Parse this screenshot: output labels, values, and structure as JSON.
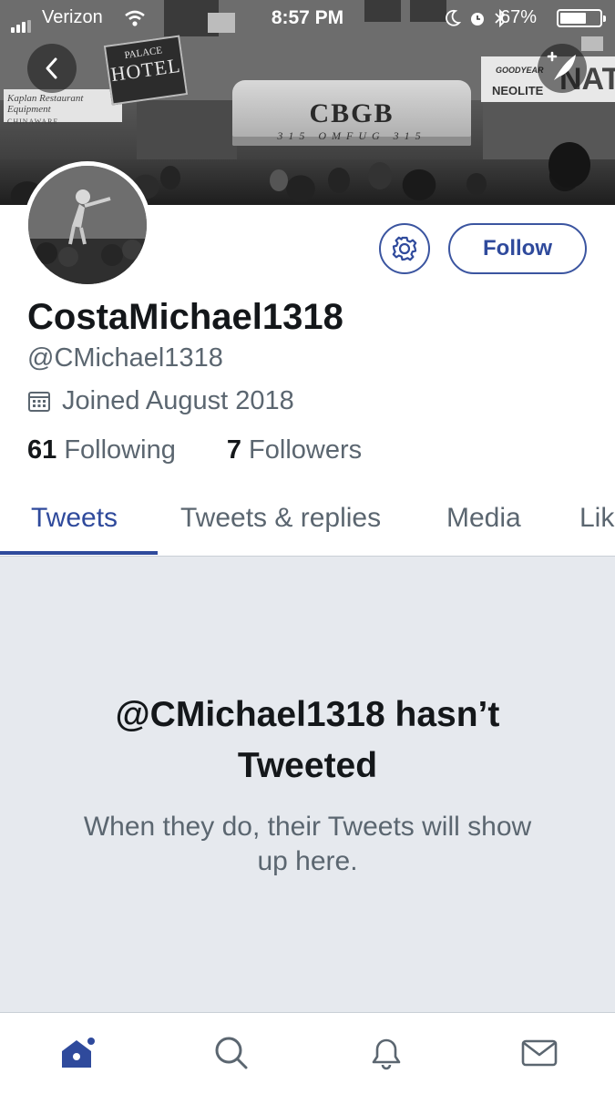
{
  "status_bar": {
    "carrier": "Verizon",
    "time": "8:57 PM",
    "battery": "67%",
    "battery_level": 0.67
  },
  "banner": {
    "hotel_sign_top": "PALACE",
    "hotel_sign_bottom": "HOTEL",
    "store_sign": "Kaplan Restaurant Equipment",
    "store_sign_small": "CHINAWARE",
    "awning_main": "CBGB",
    "awning_sub": "315  OMFUG  315",
    "shop_sign_logo": "GOODYEAR",
    "shop_sign_a": "NEOLITE",
    "shop_sign_b": "NATI"
  },
  "profile": {
    "display_name": "CostaMichael1318",
    "handle": "@CMichael1318",
    "joined": "Joined August 2018",
    "following_count": "61",
    "following_label": "Following",
    "followers_count": "7",
    "followers_label": "Followers",
    "follow_button": "Follow"
  },
  "tabs": [
    {
      "label": "Tweets",
      "active": true
    },
    {
      "label": "Tweets & replies",
      "active": false
    },
    {
      "label": "Media",
      "active": false
    },
    {
      "label": "Lik",
      "active": false
    }
  ],
  "empty_state": {
    "title": "@CMichael1318 hasn’t Tweeted",
    "subtitle": "When they do, their Tweets will show up here."
  },
  "bottom_nav": {
    "items": [
      "home-icon",
      "search-icon",
      "notifications-icon",
      "messages-icon"
    ]
  },
  "colors": {
    "accent": "#2f4a9c",
    "secondary_text": "#5b6670",
    "empty_bg": "#e6e9ee"
  }
}
